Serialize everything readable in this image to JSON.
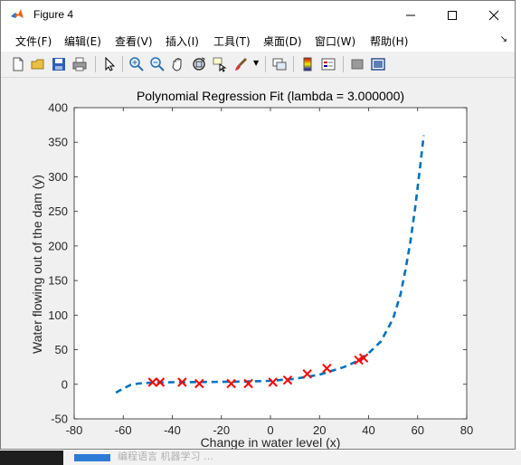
{
  "window": {
    "title": "Figure 4"
  },
  "menu": {
    "items": [
      "文件(F)",
      "编辑(E)",
      "查看(V)",
      "插入(I)",
      "工具(T)",
      "桌面(D)",
      "窗口(W)",
      "帮助(H)"
    ]
  },
  "toolbar": {
    "icons": [
      "new-figure-icon",
      "open-file-icon",
      "save-icon",
      "print-icon",
      "pointer-icon",
      "zoom-in-icon",
      "zoom-out-icon",
      "pan-icon",
      "rotate-3d-icon",
      "data-cursor-icon",
      "brush-icon",
      "link-plot-icon",
      "colorbar-icon",
      "legend-icon",
      "hide-plot-tools-icon",
      "show-plot-tools-icon"
    ]
  },
  "background": {
    "bottom_text": "编程语言 机器学习 …"
  },
  "chart_data": {
    "type": "scatter",
    "title": "Polynomial Regression Fit (lambda = 3.000000)",
    "xlabel": "Change in water level (x)",
    "ylabel": "Water flowing out of the dam (y)",
    "xlim": [
      -80,
      80
    ],
    "ylim": [
      -50,
      400
    ],
    "xticks": [
      -80,
      -60,
      -40,
      -20,
      0,
      20,
      40,
      60,
      80
    ],
    "yticks": [
      -50,
      0,
      50,
      100,
      150,
      200,
      250,
      300,
      350,
      400
    ],
    "grid": false,
    "series": [
      {
        "marker": "x",
        "color": "#ff0000",
        "x": [
          -48,
          -45,
          -36,
          -29,
          -16,
          -9,
          1,
          7,
          15,
          23,
          36,
          38
        ],
        "y": [
          3,
          3,
          3,
          1,
          1,
          1,
          3,
          6,
          15,
          23,
          35,
          38
        ]
      },
      {
        "line": "dashed",
        "color": "#0072bd",
        "x": [
          -63,
          -60,
          -57,
          -54,
          -50,
          -45,
          -40,
          -35,
          -30,
          -20,
          -10,
          0,
          10,
          20,
          30,
          35,
          40,
          45,
          50,
          53,
          55,
          57,
          59,
          61,
          62.5
        ],
        "y": [
          -12,
          -6,
          -1,
          1,
          2,
          2.5,
          3,
          3,
          3.2,
          3.5,
          4,
          5,
          8,
          14,
          25,
          33,
          45,
          62,
          95,
          130,
          165,
          205,
          255,
          315,
          360
        ]
      }
    ]
  }
}
